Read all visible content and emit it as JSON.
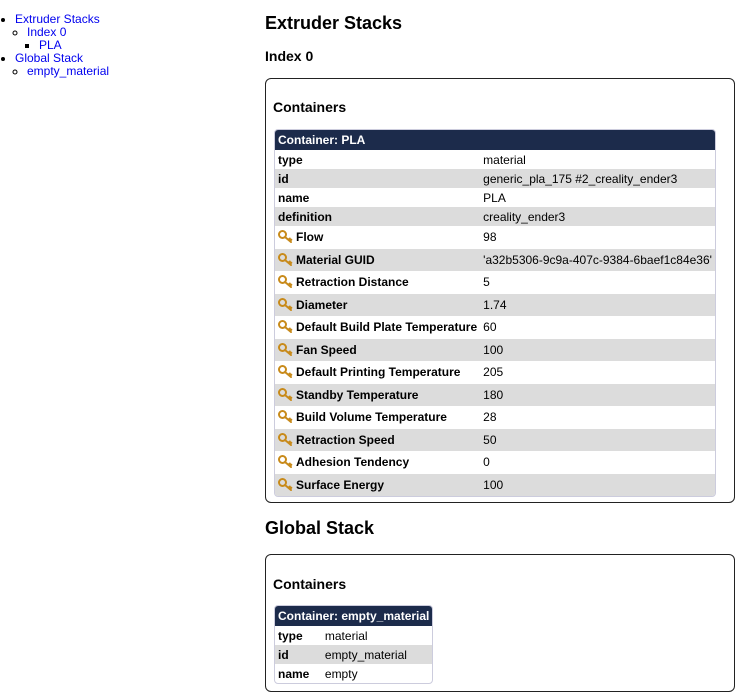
{
  "nav": {
    "items": [
      {
        "label": "Extruder Stacks",
        "children": [
          {
            "label": "Index 0",
            "children": [
              {
                "label": "PLA"
              }
            ]
          }
        ]
      },
      {
        "label": "Global Stack",
        "children": [
          {
            "label": "empty_material"
          }
        ]
      }
    ]
  },
  "extruder_section": {
    "title": "Extruder Stacks",
    "index_title": "Index 0",
    "containers_label": "Containers",
    "container": {
      "header": "Container: PLA",
      "rows": [
        {
          "key": "type",
          "value": "material",
          "icon": false
        },
        {
          "key": "id",
          "value": "generic_pla_175 #2_creality_ender3",
          "icon": false
        },
        {
          "key": "name",
          "value": "PLA",
          "icon": false
        },
        {
          "key": "definition",
          "value": "creality_ender3",
          "icon": false
        },
        {
          "key": "Flow",
          "value": "98",
          "icon": "key-icon"
        },
        {
          "key": "Material GUID",
          "value": "'a32b5306-9c9a-407c-9384-6baef1c84e36'",
          "icon": "key-icon"
        },
        {
          "key": "Retraction Distance",
          "value": "5",
          "icon": "key-icon"
        },
        {
          "key": "Diameter",
          "value": "1.74",
          "icon": "key-icon"
        },
        {
          "key": "Default Build Plate Temperature",
          "value": "60",
          "icon": "key-icon"
        },
        {
          "key": "Fan Speed",
          "value": "100",
          "icon": "key-icon"
        },
        {
          "key": "Default Printing Temperature",
          "value": "205",
          "icon": "key-icon"
        },
        {
          "key": "Standby Temperature",
          "value": "180",
          "icon": "key-icon"
        },
        {
          "key": "Build Volume Temperature",
          "value": "28",
          "icon": "key-icon"
        },
        {
          "key": "Retraction Speed",
          "value": "50",
          "icon": "key-icon"
        },
        {
          "key": "Adhesion Tendency",
          "value": "0",
          "icon": "key-icon"
        },
        {
          "key": "Surface Energy",
          "value": "100",
          "icon": "key-icon"
        }
      ]
    }
  },
  "global_section": {
    "title": "Global Stack",
    "containers_label": "Containers",
    "container": {
      "header": "Container: empty_material",
      "rows": [
        {
          "key": "type",
          "value": "material"
        },
        {
          "key": "id",
          "value": "empty_material"
        },
        {
          "key": "name",
          "value": "empty"
        }
      ]
    }
  },
  "colors": {
    "header_bg": "#1c2b4b",
    "row_alt": "#dcdcdc",
    "link": "#0000ee",
    "key_icon": "#c88a1a"
  }
}
